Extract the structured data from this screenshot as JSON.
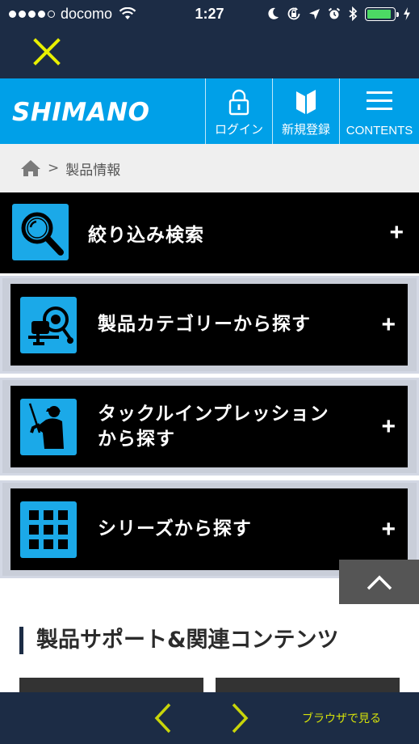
{
  "status_bar": {
    "carrier": "docomo",
    "time": "1:27",
    "battery_level": 0.9,
    "battery_color": "#4cd964"
  },
  "header": {
    "brand": "SHIMANO",
    "login_label": "ログイン",
    "register_label": "新規登録",
    "contents_label": "CONTENTS",
    "bg_color": "#00a0e8"
  },
  "breadcrumb": {
    "separator": ">",
    "current": "製品情報"
  },
  "menu": {
    "filter_search": {
      "label": "絞り込み検索",
      "icon": "magnifier-icon"
    },
    "categories": [
      {
        "line1": "製品カテゴリーから探す",
        "line2": "",
        "icon": "fishing-reel-icon"
      },
      {
        "line1": "タックルインプレッション",
        "line2": "から探す",
        "icon": "angler-icon"
      },
      {
        "line1": "シリーズから探す",
        "line2": "",
        "icon": "grid-icon"
      }
    ],
    "expand_symbol": "+"
  },
  "support": {
    "title": "製品サポート&関連コンテンツ"
  },
  "bottom_bar": {
    "browser_link": "ブラウザで見る",
    "accent_color": "#d4e10a"
  }
}
